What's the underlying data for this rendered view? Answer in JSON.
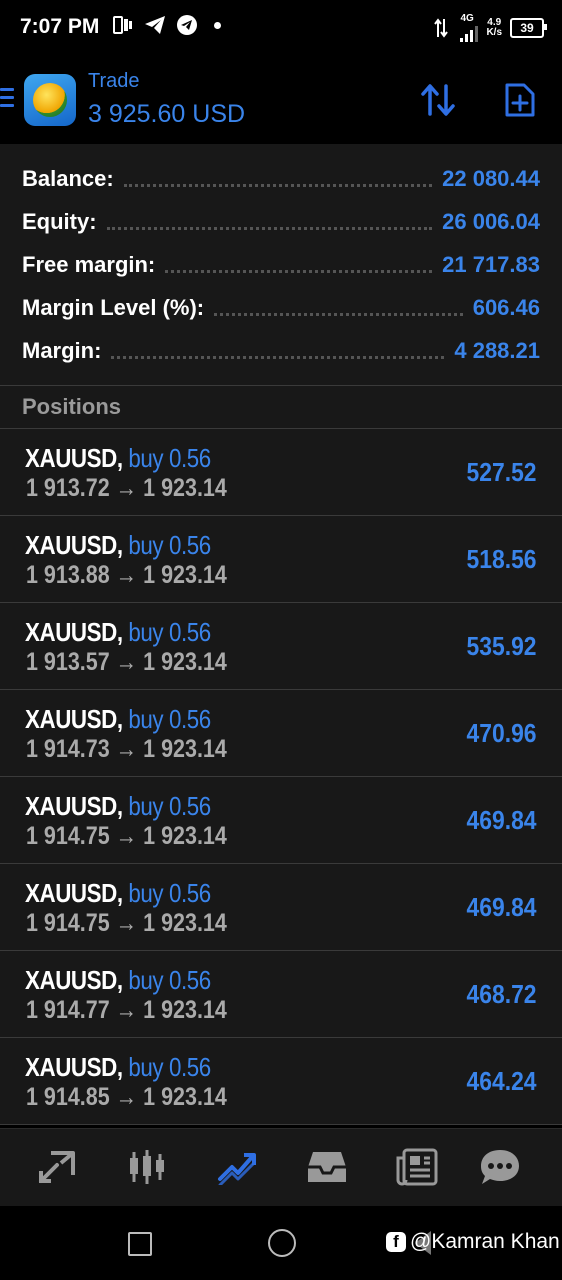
{
  "status_bar": {
    "time": "7:07 PM",
    "network_label": "4G",
    "speed_value": "4.9",
    "speed_unit": "K/s",
    "battery": "39"
  },
  "header": {
    "title": "Trade",
    "subtitle": "3 925.60 USD"
  },
  "summary": [
    {
      "label": "Balance:",
      "value": "22 080.44"
    },
    {
      "label": "Equity:",
      "value": "26 006.04"
    },
    {
      "label": "Free margin:",
      "value": "21 717.83"
    },
    {
      "label": "Margin Level (%):",
      "value": "606.46"
    },
    {
      "label": "Margin:",
      "value": "4 288.21"
    }
  ],
  "positions_header": "Positions",
  "positions": [
    {
      "symbol": "XAUUSD,",
      "side": "buy 0.56",
      "prices": "1 913.72 → 1 923.14",
      "profit": "527.52"
    },
    {
      "symbol": "XAUUSD,",
      "side": "buy 0.56",
      "prices": "1 913.88 → 1 923.14",
      "profit": "518.56"
    },
    {
      "symbol": "XAUUSD,",
      "side": "buy 0.56",
      "prices": "1 913.57 → 1 923.14",
      "profit": "535.92"
    },
    {
      "symbol": "XAUUSD,",
      "side": "buy 0.56",
      "prices": "1 914.73 → 1 923.14",
      "profit": "470.96"
    },
    {
      "symbol": "XAUUSD,",
      "side": "buy 0.56",
      "prices": "1 914.75 → 1 923.14",
      "profit": "469.84"
    },
    {
      "symbol": "XAUUSD,",
      "side": "buy 0.56",
      "prices": "1 914.75 → 1 923.14",
      "profit": "469.84"
    },
    {
      "symbol": "XAUUSD,",
      "side": "buy 0.56",
      "prices": "1 914.77 → 1 923.14",
      "profit": "468.72"
    },
    {
      "symbol": "XAUUSD,",
      "side": "buy 0.56",
      "prices": "1 914.85 → 1 923.14",
      "profit": "464.24"
    }
  ],
  "bottom_nav": [
    {
      "icon": "quotes-icon",
      "active": false
    },
    {
      "icon": "chart-icon",
      "active": false
    },
    {
      "icon": "trade-icon",
      "active": true
    },
    {
      "icon": "history-icon",
      "active": false
    },
    {
      "icon": "news-icon",
      "active": false
    },
    {
      "icon": "messages-icon",
      "active": false
    }
  ],
  "watermark": "@Kamran Khan",
  "colors": {
    "accent": "#3a84ea",
    "panel": "#181818",
    "muted": "#aaaaaa"
  }
}
